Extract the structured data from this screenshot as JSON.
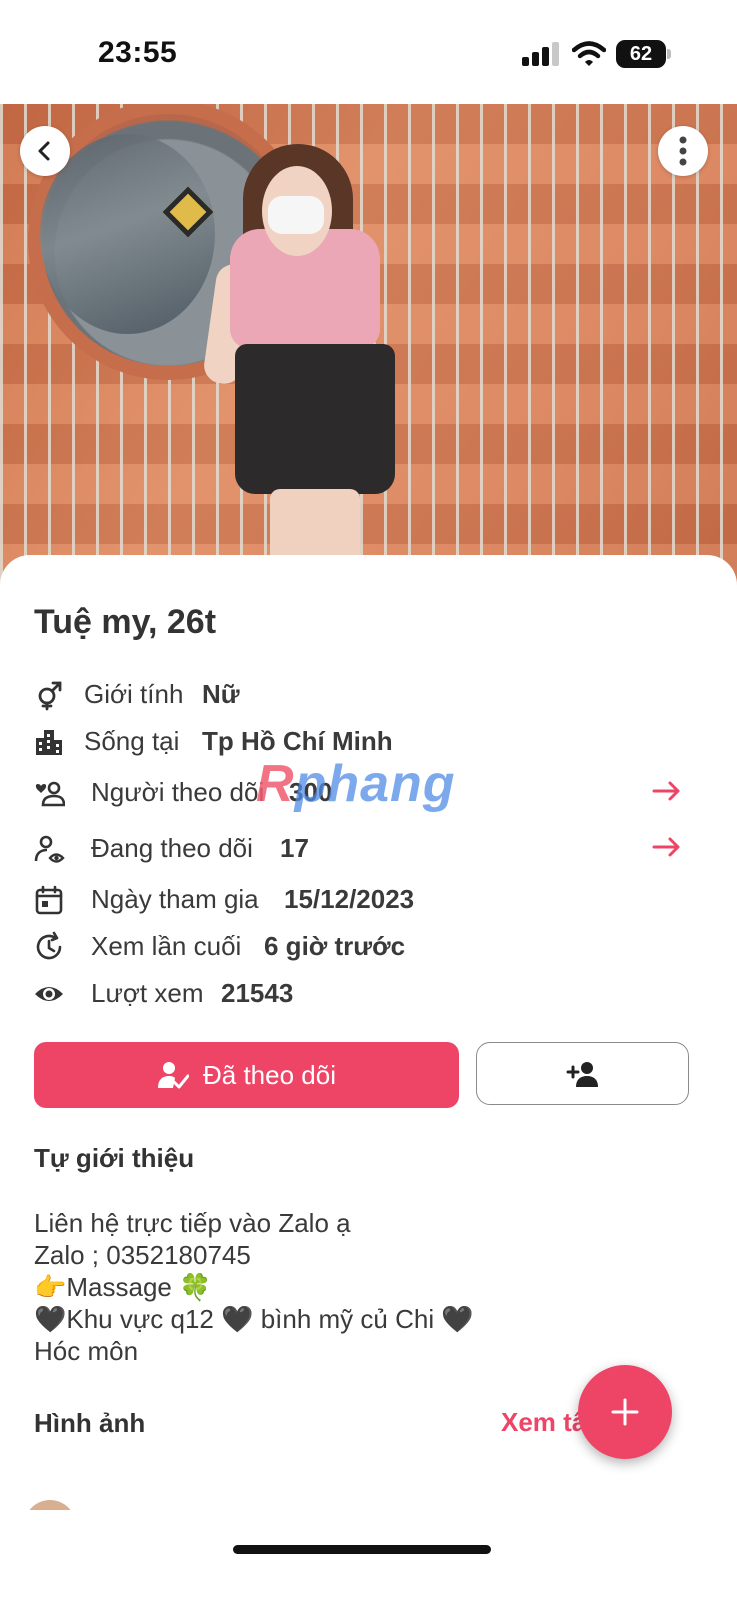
{
  "status_bar": {
    "time": "23:55",
    "battery": "62"
  },
  "profile": {
    "name": "Tuệ my, 26t"
  },
  "info": {
    "gender_label": "Giới tính",
    "gender_value": "Nữ",
    "location_label": "Sống tại",
    "location_value": "Tp Hồ Chí Minh",
    "followers_label": "Người theo dõi",
    "followers_value": "300",
    "following_label": "Đang theo dõi",
    "following_value": "17",
    "joined_label": "Ngày tham gia",
    "joined_value": "15/12/2023",
    "last_seen_label": "Xem lần cuối",
    "last_seen_value": "6 giờ trước",
    "views_label": "Lượt xem",
    "views_value": "21543"
  },
  "watermark": {
    "prefix": "R",
    "rest": "phang"
  },
  "actions": {
    "follow_label": "Đã theo dõi"
  },
  "about": {
    "title": "Tự giới thiệu",
    "text": "Liên hệ trực tiếp vào Zalo ạ\nZalo ; 0352180745\n👉Massage 🍀\n🖤Khu vực q12 🖤 bình mỹ củ Chi 🖤\nHóc môn"
  },
  "photos": {
    "title": "Hình ảnh",
    "see_all": "Xem tất cả"
  },
  "icons": {
    "gender": "gender-icon",
    "location": "building-icon",
    "followers": "followers-icon",
    "following": "following-icon",
    "joined": "calendar-icon",
    "last_seen": "history-icon",
    "views": "eye-icon",
    "follow": "user-check-icon",
    "add_friend": "user-plus-icon",
    "back": "chevron-left-icon",
    "more": "more-vertical-icon",
    "fab": "plus-icon"
  },
  "colors": {
    "accent": "#ee4466",
    "text": "#3a3a3a"
  }
}
